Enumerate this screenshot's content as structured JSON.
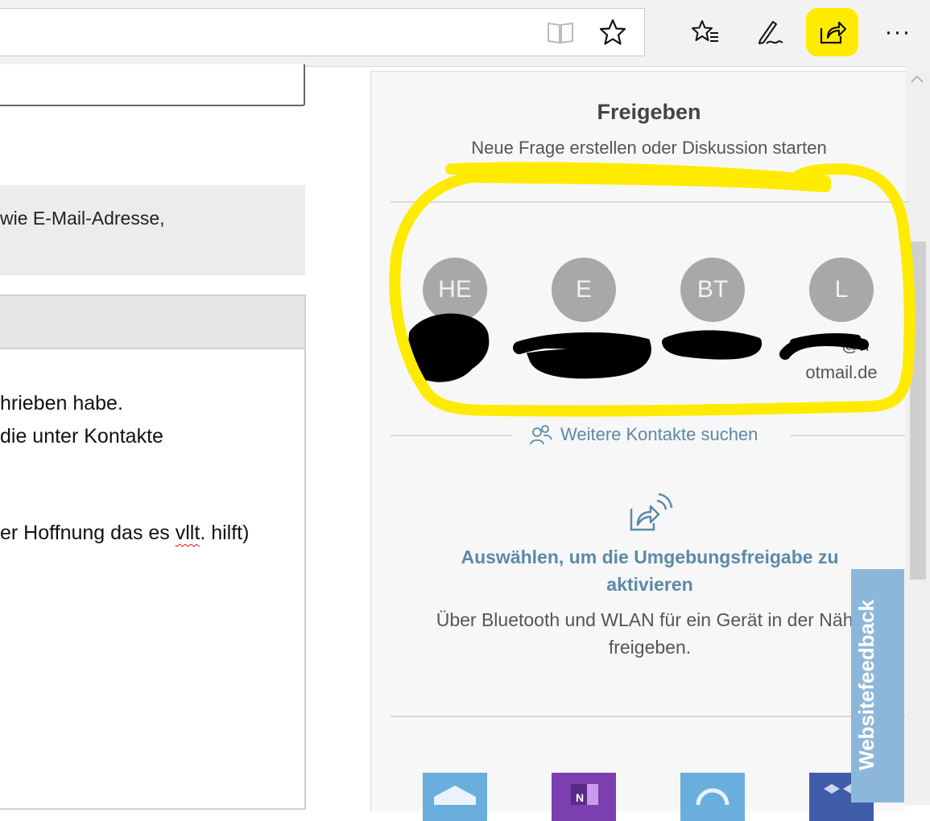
{
  "toolbar": {
    "reading_view_icon": "book-icon",
    "favorite_icon": "star-icon",
    "favorites_hub_icon": "favorites-list-icon",
    "notes_icon": "pen-icon",
    "share_icon": "share-icon",
    "more_label": "···"
  },
  "page": {
    "grey_box_text": "wie E-Mail-Adresse,",
    "post_lines": [
      "hrieben habe.",
      "die unter Kontakte",
      "er Hoffnung das es ",
      "vllt",
      ". hilft)"
    ]
  },
  "share_panel": {
    "title": "Freigeben",
    "subtitle": "Neue Frage erstellen oder Diskussion starten",
    "contacts": [
      {
        "initials": "HE",
        "label": ""
      },
      {
        "initials": "E",
        "label": ""
      },
      {
        "initials": "BT",
        "label": ""
      },
      {
        "initials": "L",
        "label": "@h otmail.de",
        "label_line1": "@h",
        "label_line2": "otmail.de"
      }
    ],
    "more_contacts_label": "Weitere Kontakte suchen",
    "nearby_title": "Auswählen, um die Umgebungsfreigabe zu aktivieren",
    "nearby_description": "Über Bluetooth und WLAN für ein Gerät in der Nähe freigeben.",
    "apps": [
      "mail-app-icon",
      "onenote-app-icon",
      "cortana-app-icon",
      "dropbox-app-icon"
    ]
  },
  "feedback_tab": "Websitefeedback",
  "colors": {
    "highlight": "#ffeb00",
    "link": "#5b8aa6",
    "avatar": "#a8a8a8",
    "feedback": "#8db7da"
  }
}
